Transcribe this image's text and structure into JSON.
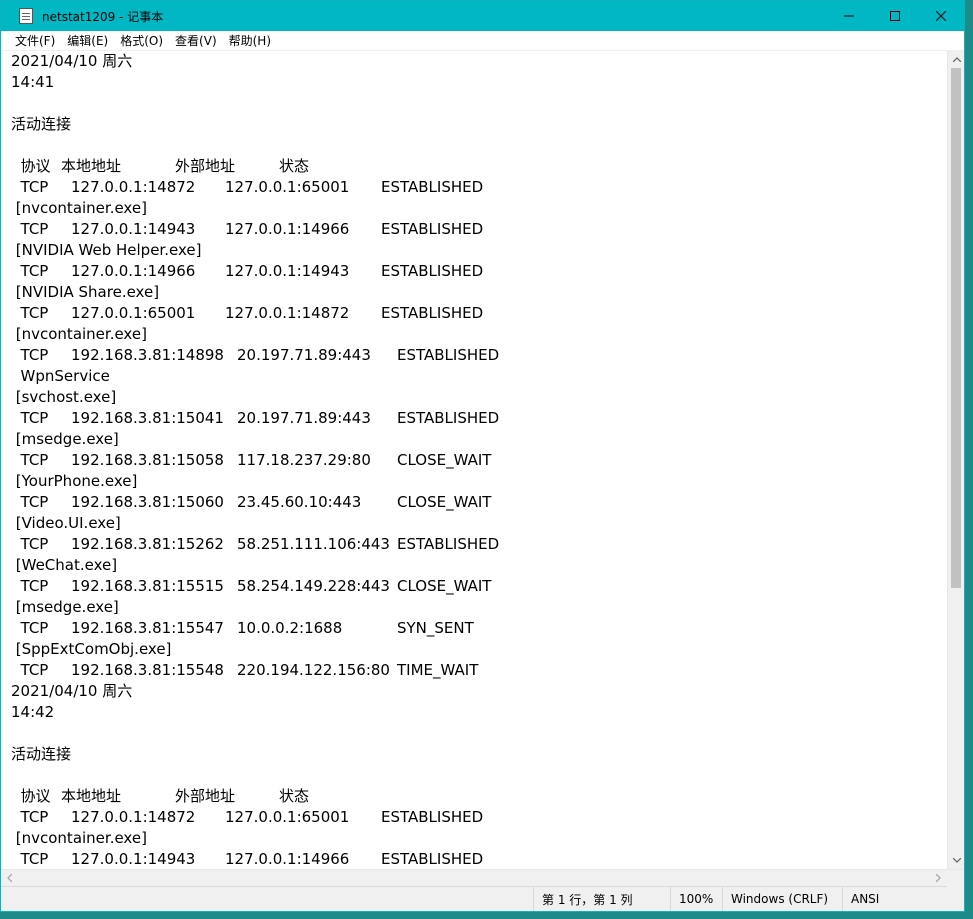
{
  "window": {
    "title": "netstat1209 - 记事本",
    "minimize_icon": "minimize-icon",
    "maximize_icon": "maximize-icon",
    "close_icon": "close-icon"
  },
  "menu": {
    "items": [
      {
        "label": "文件(F)"
      },
      {
        "label": "编辑(E)"
      },
      {
        "label": "格式(O)"
      },
      {
        "label": "查看(V)"
      },
      {
        "label": "帮助(H)"
      }
    ]
  },
  "content": {
    "lines": [
      [
        "2021/04/10 周六"
      ],
      [
        "14:41"
      ],
      [
        ""
      ],
      [
        "活动连接"
      ],
      [
        ""
      ],
      [
        "  协议",
        "本地地址",
        "外部地址",
        "状态"
      ],
      [
        "  TCP",
        "127.0.0.1:14872",
        "127.0.0.1:65001",
        "ESTABLISHED"
      ],
      [
        " [nvcontainer.exe]"
      ],
      [
        "  TCP",
        "127.0.0.1:14943",
        "127.0.0.1:14966",
        "ESTABLISHED"
      ],
      [
        " [NVIDIA Web Helper.exe]"
      ],
      [
        "  TCP",
        "127.0.0.1:14966",
        "127.0.0.1:14943",
        "ESTABLISHED"
      ],
      [
        " [NVIDIA Share.exe]"
      ],
      [
        "  TCP",
        "127.0.0.1:65001",
        "127.0.0.1:14872",
        "ESTABLISHED"
      ],
      [
        " [nvcontainer.exe]"
      ],
      [
        "  TCP",
        "192.168.3.81:14898",
        "20.197.71.89:443",
        "ESTABLISHED"
      ],
      [
        "  WpnService"
      ],
      [
        " [svchost.exe]"
      ],
      [
        "  TCP",
        "192.168.3.81:15041",
        "20.197.71.89:443",
        "ESTABLISHED"
      ],
      [
        " [msedge.exe]"
      ],
      [
        "  TCP",
        "192.168.3.81:15058",
        "117.18.237.29:80",
        "CLOSE_WAIT"
      ],
      [
        " [YourPhone.exe]"
      ],
      [
        "  TCP",
        "192.168.3.81:15060",
        "23.45.60.10:443",
        "CLOSE_WAIT"
      ],
      [
        " [Video.UI.exe]"
      ],
      [
        "  TCP",
        "192.168.3.81:15262",
        "58.251.111.106:443",
        "ESTABLISHED"
      ],
      [
        " [WeChat.exe]"
      ],
      [
        "  TCP",
        "192.168.3.81:15515",
        "58.254.149.228:443",
        "CLOSE_WAIT"
      ],
      [
        " [msedge.exe]"
      ],
      [
        "  TCP",
        "192.168.3.81:15547",
        "10.0.0.2:1688",
        "SYN_SENT"
      ],
      [
        " [SppExtComObj.exe]"
      ],
      [
        "  TCP",
        "192.168.3.81:15548",
        "220.194.122.156:80",
        "TIME_WAIT"
      ],
      [
        "2021/04/10 周六"
      ],
      [
        "14:42"
      ],
      [
        ""
      ],
      [
        "活动连接"
      ],
      [
        ""
      ],
      [
        "  协议",
        "本地地址",
        "外部地址",
        "状态"
      ],
      [
        "  TCP",
        "127.0.0.1:14872",
        "127.0.0.1:65001",
        "ESTABLISHED"
      ],
      [
        " [nvcontainer.exe]"
      ],
      [
        "  TCP",
        "127.0.0.1:14943",
        "127.0.0.1:14966",
        "ESTABLISHED"
      ]
    ]
  },
  "status": {
    "position": "第 1 行，第 1 列",
    "zoom": "100%",
    "line_ending": "Windows (CRLF)",
    "encoding": "ANSI"
  },
  "colors": {
    "titlebar": "#00b7c3",
    "desktop": "#1f8a8a"
  }
}
